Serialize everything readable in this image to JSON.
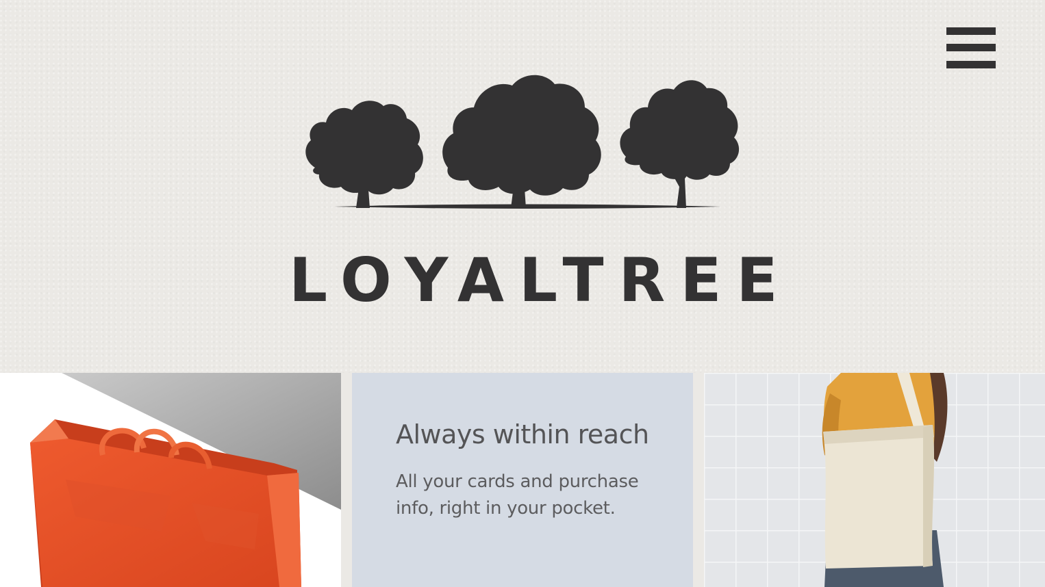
{
  "brand": {
    "name": "LOYALTREE",
    "logo_icon": "three-trees-icon",
    "text_color": "#333233"
  },
  "header": {
    "menu_icon": "hamburger-menu-icon"
  },
  "feature": {
    "title": "Always within reach",
    "body": "All your cards and purchase info, right in your pocket.",
    "background": "#d5dbe4"
  },
  "tiles": {
    "left_image": "orange-shopping-bag-photo",
    "right_image": "person-with-tote-bag-photo"
  },
  "colors": {
    "hero_background": "#ebe9e5",
    "accent_orange": "#e5502a"
  }
}
